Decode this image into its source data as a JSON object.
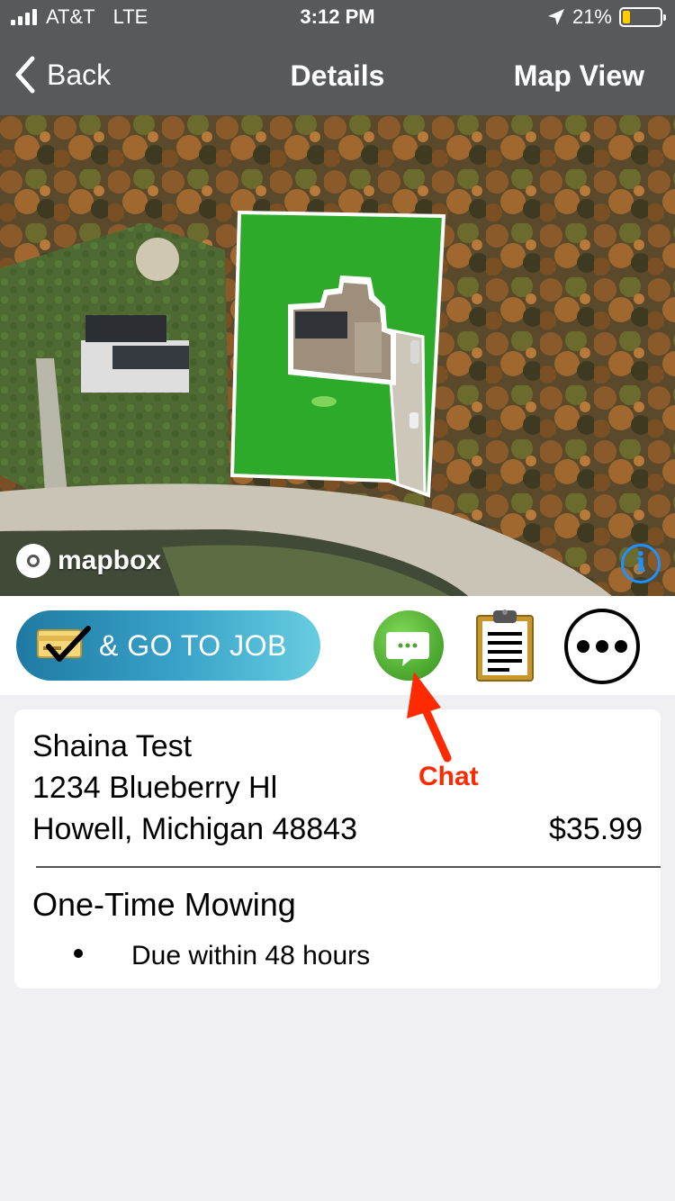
{
  "status_bar": {
    "carrier": "AT&T",
    "network": "LTE",
    "time": "3:12 PM",
    "battery": "21%",
    "battery_level": 0.21
  },
  "nav": {
    "back_label": "Back",
    "title": "Details",
    "right_label": "Map View"
  },
  "map": {
    "attribution": "mapbox",
    "info_label": "i"
  },
  "actions": {
    "go_to_job_label": "& GO TO JOB"
  },
  "job": {
    "customer_name": "Shaina Test",
    "address_line1": "1234 Blueberry Hl",
    "address_line2": "Howell, Michigan 48843",
    "price": "$35.99",
    "service": "One-Time Mowing",
    "notes": [
      "Due within 48 hours"
    ]
  },
  "annotation": {
    "label": "Chat"
  },
  "colors": {
    "nav_bg": "#58595b",
    "go_gradient_start": "#1f7aa3",
    "go_gradient_end": "#68cde0",
    "chat_green": "#4aa52e",
    "annotation_red": "#ff2a00",
    "page_bg": "#efeff4"
  }
}
